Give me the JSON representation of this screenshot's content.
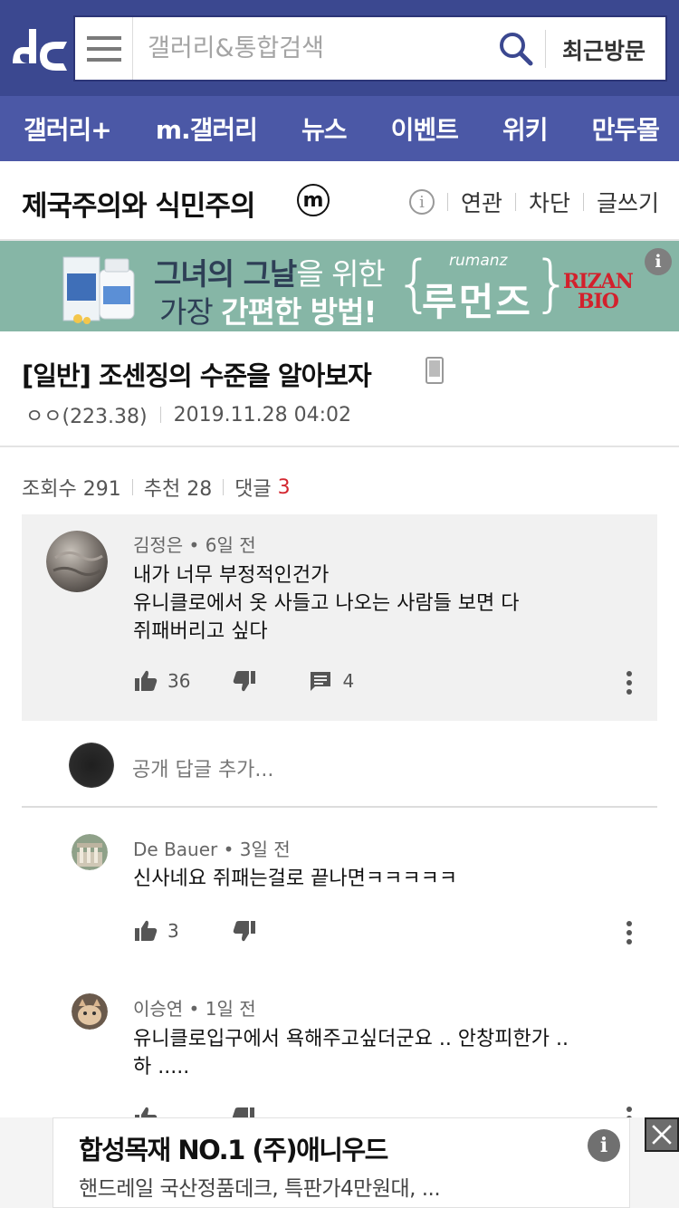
{
  "header": {
    "search_placeholder": "갤러리&통합검색",
    "recent_label": "최근방문"
  },
  "nav": {
    "items": [
      "갤러리+",
      "m.갤러리",
      "뉴스",
      "이벤트",
      "위키",
      "만두몰"
    ]
  },
  "gallery": {
    "title": "제국주의와 식민주의",
    "badge": "m",
    "info_icon": "i",
    "actions": [
      "연관",
      "차단",
      "글쓰기"
    ]
  },
  "banner": {
    "line1_bold": "그녀의 그날",
    "line1_light": "을 위한",
    "line2_light": "가장 ",
    "line2_bold": "간편한 방법!",
    "brand_sub": "rumanz",
    "brand_main": "루먼즈",
    "logo_top": "RIZAN",
    "logo_bottom": "BIO",
    "info": "i",
    "brand_color": "#86b6a6"
  },
  "post": {
    "title": "[일반] 조센징의 수준을 알아보자",
    "author": "ㅇㅇ(223.38)",
    "datetime": "2019.11.28 04:02",
    "views_label": "조회수 291",
    "recommend_label": "추천 28",
    "comment_label": "댓글",
    "comment_count": "3"
  },
  "main_comment": {
    "author": "김정은",
    "time": "6일 전",
    "lines": [
      "내가 너무 부정적인건가",
      "유니클로에서 옷 사들고 나오는 사람들 보면 다",
      "쥐패버리고 싶다"
    ],
    "likes": "36",
    "replies": "4"
  },
  "reply_input": {
    "placeholder": "공개 답글 추가..."
  },
  "replies": [
    {
      "author": "De Bauer",
      "time": "3일 전",
      "lines": [
        "신사네요 쥐패는걸로 끝나면ㅋㅋㅋㅋㅋ"
      ],
      "likes": "3"
    },
    {
      "author": "이승연",
      "time": "1일 전",
      "lines": [
        "유니클로입구에서 욕해주고싶더군요 .. 안창피한가 ..",
        "하 ....."
      ],
      "likes": ""
    }
  ],
  "bottom_ad": {
    "title": "합성목재 NO.1 (주)애니우드",
    "subtitle": "핸드레일 국산정품데크, 특판가4만원대, ...",
    "info": "i"
  },
  "colors": {
    "header_bg": "#3b4890",
    "nav_bg": "#4b58a6",
    "accent_red": "#d3262f"
  }
}
